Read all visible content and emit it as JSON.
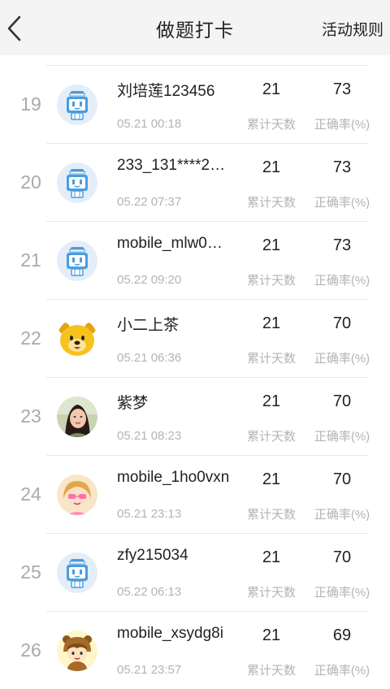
{
  "header": {
    "title": "做题打卡",
    "rules_label": "活动规则"
  },
  "labels": {
    "days": "累计天数",
    "rate": "正确率(%)"
  },
  "colors": {
    "background": "#f4f4f4",
    "panel": "#ffffff",
    "muted_text": "#b4b4b4",
    "robot_blue": "#4a9de0"
  },
  "rows": [
    {
      "rank": "19",
      "name": "刘培莲123456",
      "time": "05.21 00:18",
      "days": "21",
      "rate": "73",
      "avatar": "robot-avatar"
    },
    {
      "rank": "20",
      "name": "233_131****2…",
      "time": "05.22 07:37",
      "days": "21",
      "rate": "73",
      "avatar": "robot-avatar"
    },
    {
      "rank": "21",
      "name": "mobile_mlw0…",
      "time": "05.22 09:20",
      "days": "21",
      "rate": "73",
      "avatar": "robot-avatar"
    },
    {
      "rank": "22",
      "name": "小二上茶",
      "time": "05.21 06:36",
      "days": "21",
      "rate": "70",
      "avatar": "bear-avatar"
    },
    {
      "rank": "23",
      "name": "紫梦",
      "time": "05.21 08:23",
      "days": "21",
      "rate": "70",
      "avatar": "photo-avatar"
    },
    {
      "rank": "24",
      "name": "mobile_1ho0vxn",
      "time": "05.21 23:13",
      "days": "21",
      "rate": "70",
      "avatar": "girl-avatar"
    },
    {
      "rank": "25",
      "name": "zfy215034",
      "time": "05.22 06:13",
      "days": "21",
      "rate": "70",
      "avatar": "robot-avatar"
    },
    {
      "rank": "26",
      "name": "mobile_xsydg8i",
      "time": "05.21 23:57",
      "days": "21",
      "rate": "69",
      "avatar": "costume-avatar"
    }
  ]
}
